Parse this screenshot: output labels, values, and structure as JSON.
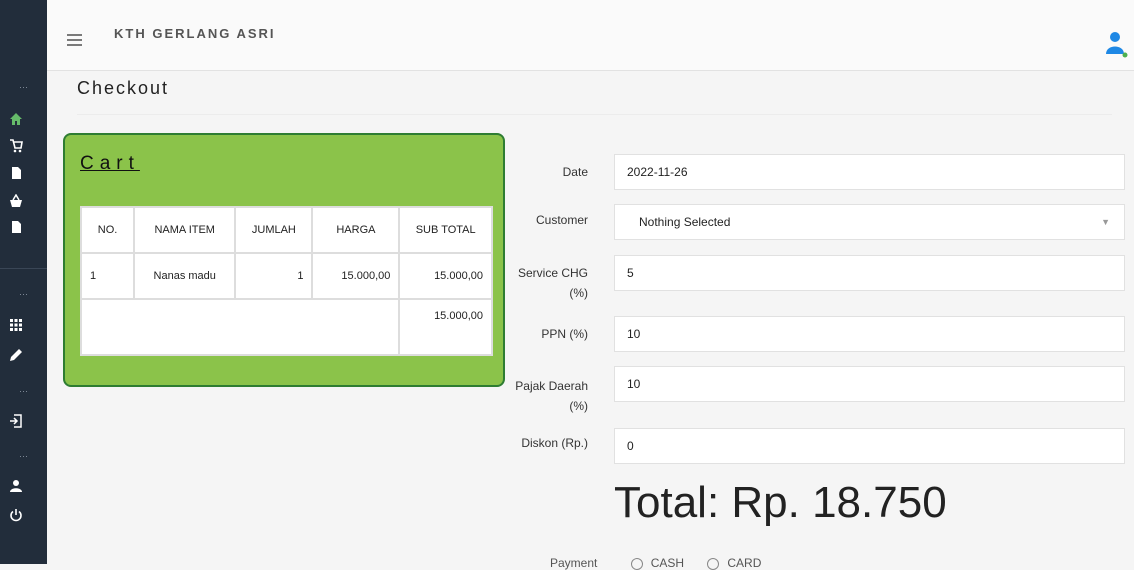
{
  "topbar": {
    "brand": "KTH GERLANG ASRI"
  },
  "page": {
    "title": "Checkout"
  },
  "cart": {
    "title": "Cart",
    "columns": [
      "NO.",
      "NAMA ITEM",
      "JUMLAH",
      "HARGA",
      "SUB TOTAL"
    ],
    "rows": [
      {
        "no": "1",
        "item": "Nanas madu",
        "jumlah": "1",
        "harga": "15.000,00",
        "subtotal": "15.000,00"
      }
    ],
    "grand_total": "15.000,00"
  },
  "form": {
    "date_label": "Date",
    "date_value": "2022-11-26",
    "customer_label": "Customer",
    "customer_value": "Nothing Selected",
    "service_label_1": "Service CHG",
    "service_label_2": "(%)",
    "service_value": "5",
    "ppn_label": "PPN (%)",
    "ppn_value": "10",
    "pajak_label_1": "Pajak Daerah",
    "pajak_label_2": "(%)",
    "pajak_value": "10",
    "diskon_label": "Diskon (Rp.)",
    "diskon_value": "0",
    "total": "Total: Rp. 18.750",
    "payment_label": "Payment",
    "payment_options": [
      "CASH",
      "CARD"
    ]
  },
  "sidebar": {
    "icons": [
      "home-icon",
      "cart-icon",
      "file-icon",
      "basket-icon",
      "file-icon",
      "grid-icon",
      "pencil-icon",
      "logout-icon",
      "user-icon",
      "power-icon"
    ]
  },
  "colors": {
    "cart_bg": "#8bc34a",
    "cart_border": "#2e7d32",
    "sidebar_bg": "#222d3b",
    "active_icon": "#66bb6a",
    "user_icon": "#1e88e5"
  }
}
